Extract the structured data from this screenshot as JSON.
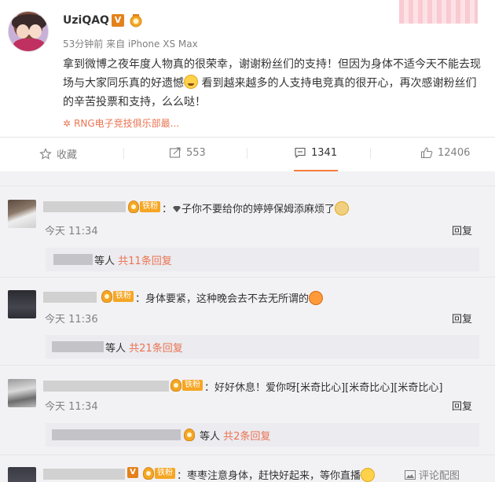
{
  "post": {
    "username": "UziQAQ",
    "verified_mark": "V",
    "meta": "53分钟前 来自 iPhone XS Max",
    "text_part1": "拿到微博之夜年度人物真的很荣幸，谢谢粉丝们的支持！但因为身体不适今天不能去现场与大家同乐真的好遗憾",
    "text_part2": "看到越来越多的人支持电竞真的很开心，再次感谢粉丝们的辛苦投票和支持，么么哒！",
    "tag": "RNG电子竞技俱乐部最..."
  },
  "actions": {
    "favorite_label": "收藏",
    "repost_count": "553",
    "comment_count": "1341",
    "like_count": "12406"
  },
  "comments": [
    {
      "fan_label": "铁粉",
      "text": "子你不要给你的婷婷保姆添麻烦了",
      "time": "今天 11:34",
      "reply": "回复",
      "reply_summary_prefix": "等人",
      "reply_summary_link": "共11条回复"
    },
    {
      "fan_label": "铁粉",
      "text": "：身体要紧，这种晚会去不去无所谓的",
      "time": "今天 11:36",
      "reply": "回复",
      "reply_summary_prefix": "等人",
      "reply_summary_link": "共21条回复"
    },
    {
      "fan_label": "铁粉",
      "text": "：好好休息！爱你呀[米奇比心][米奇比心][米奇比心]",
      "time": "今天 11:34",
      "reply": "回复",
      "reply_summary_prefix": "等人",
      "reply_summary_link": "共2条回复"
    },
    {
      "fan_label": "铁粉",
      "text": "：枣枣注意身体，赶快好起来，等你直播",
      "report": "评论配图"
    }
  ],
  "colors": {
    "accent": "#eb7350",
    "fan_badge": "#f5a623",
    "muted": "#808080"
  }
}
